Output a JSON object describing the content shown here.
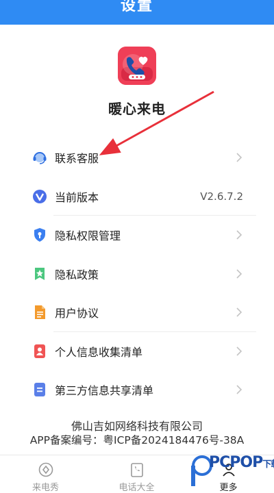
{
  "header": {
    "title": "设置"
  },
  "app": {
    "name": "暖心来电"
  },
  "menu": [
    {
      "label": "联系客服",
      "icon": "headset-icon",
      "value": ""
    },
    {
      "label": "当前版本",
      "icon": "version-v-icon",
      "value": "V2.6.7.2"
    },
    {
      "label": "隐私权限管理",
      "icon": "privacy-shield-icon",
      "value": ""
    },
    {
      "label": "隐私政策",
      "icon": "bookmark-star-icon",
      "value": ""
    },
    {
      "label": "用户协议",
      "icon": "document-icon",
      "value": ""
    },
    {
      "label": "个人信息收集清单",
      "icon": "person-card-icon",
      "value": ""
    },
    {
      "label": "第三方信息共享清单",
      "icon": "list-document-icon",
      "value": ""
    }
  ],
  "footer": {
    "company": "佛山吉如网络科技有限公司",
    "record": "APP备案编号：粤ICP备2024184476号-38A"
  },
  "bottom_nav": [
    {
      "label": "来电秀",
      "icon": "target-icon"
    },
    {
      "label": "电话大全",
      "icon": "phonebook-icon"
    },
    {
      "label": "更多",
      "icon": "person-more-icon"
    }
  ],
  "watermark": {
    "text": "PCPOP",
    "suffix": "下载"
  },
  "colors": {
    "header": "#2f8bf3",
    "logo": "#ef3f57",
    "arrow": "#e8303a"
  }
}
